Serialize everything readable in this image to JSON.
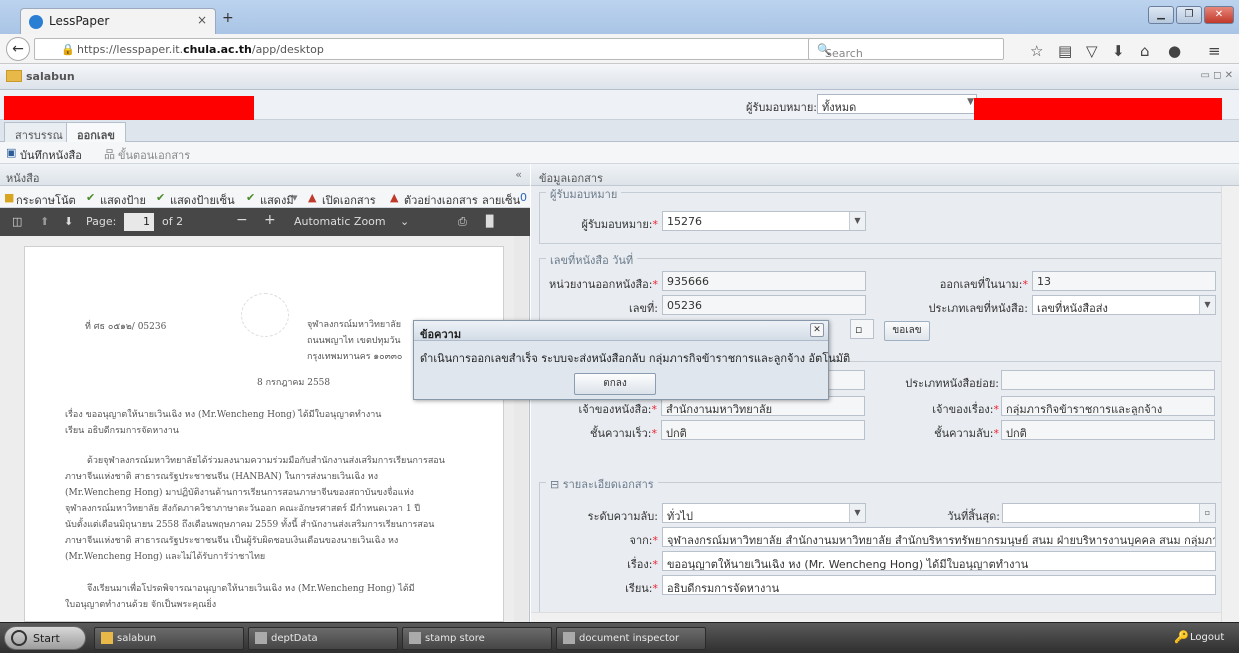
{
  "browser": {
    "tab_title": "LessPaper",
    "tab_close": "×",
    "new_tab": "+",
    "url_prefix": "https://lesspaper.it.",
    "url_host": "chula.ac.th",
    "url_path": "/app/desktop",
    "search_placeholder": "Search"
  },
  "app": {
    "window_title": "salabun",
    "filter_label": "ผู้รับมอบหมาย:",
    "filter_value": "ทั้งหมด",
    "tabs": [
      "สารบรรณ",
      "ออกเลข"
    ],
    "save_label": "บันทึกหนังสือ",
    "steps_label": "ขั้นตอนเอกสาร"
  },
  "left": {
    "header": "หนังสือ",
    "tools": [
      "กระดาษโน้ต",
      "แสดงป้าย",
      "แสดงป้ายเซ็น",
      "แสดงมี",
      "เปิดเอกสาร",
      "ตัวอย่างเอกสาร",
      "ลายเซ็น",
      "0"
    ],
    "pdf": {
      "page_label": "Page:",
      "page_num": "1",
      "page_total": "of 2",
      "zoom": "Automatic Zoom"
    },
    "doc": {
      "ref": "ที่ ศธ ๐๕๑๒/ 05236",
      "org1": "จุฬาลงกรณ์มหาวิทยาลัย",
      "org2": "ถนนพญาไท เขตปทุมวัน",
      "org3": "กรุงเทพมหานคร ๑๐๓๓๐",
      "date": "8 กรกฎาคม 2558",
      "subject": "เรื่อง ขออนุญาตให้นายเวินเฉิง หง (Mr.Wencheng Hong) ได้มีใบอนุญาตทำงาน",
      "to": "เรียน อธิบดีกรมการจัดหางาน",
      "p1": "ด้วยจุฬาลงกรณ์มหาวิทยาลัยได้ร่วมลงนามความร่วมมือกับสำนักงานส่งเสริมการเรียนการสอน",
      "p2": "ภาษาจีนแห่งชาติ สาธารณรัฐประชาชนจีน (HANBAN) ในการส่งนายเวินเฉิง หง",
      "p3": "(Mr.Wencheng Hong) มาปฏิบัติงานด้านการเรียนการสอนภาษาจีนของสถาบันขงจื่อแห่ง",
      "p4": "จุฬาลงกรณ์มหาวิทยาลัย สังกัดภาควิชาภาษาตะวันออก คณะอักษรศาสตร์ มีกำหนดเวลา 1 ปี",
      "p5": "นับตั้งแต่เดือนมิถุนายน 2558 ถึงเดือนพฤษภาคม 2559 ทั้งนี้ สำนักงานส่งเสริมการเรียนการสอน",
      "p6": "ภาษาจีนแห่งชาติ สาธารณรัฐประชาชนจีน เป็นผู้รับผิดชอบเงินเดือนของนายเวินเฉิง หง",
      "p7": "(Mr.Wencheng Hong) และไม่ได้รับการัว่าชาไทย",
      "p8": "จึงเรียนมาเพื่อโปรดพิจารณาอนุญาตให้นายเวินเฉิง หง (Mr.Wencheng Hong) ได้มี",
      "p9": "ใบอนุญาตทำงานด้วย จักเป็นพระคุณยิ่ง"
    }
  },
  "right": {
    "header": "ข้อมูลเอกสาร",
    "assignee_section": "ผู้รับมอบหมาย",
    "assignee_label": "ผู้รับมอบหมาย:",
    "assignee_value": "15276",
    "number_section": "เลขที่หนังสือ วันที่",
    "issuer_label": "หน่วยงานออกหนังสือ:",
    "issuer_value": "935666",
    "internal_label": "ออกเลขที่ในนาม:",
    "internal_value": "13",
    "no_label": "เลขที่:",
    "no_value": "05236",
    "type_label": "ประเภทเลขที่หนังสือ:",
    "type_value": "เลขที่หนังสือส่ง",
    "request_btn": "ขอเลข",
    "subtype_label": "ประเภทหนังสือย่อย:",
    "owner_label": "เจ้าของหนังสือ:",
    "owner_value": "สำนักงานมหาวิทยาลัย",
    "story_owner_label": "เจ้าของเรื่อง:",
    "story_owner_value": "กลุ่มภารกิจข้าราชการและลูกจ้าง",
    "urgency_label": "ชั้นความเร็ว:",
    "urgency_value": "ปกติ",
    "secret_label": "ชั้นความลับ:",
    "secret_value": "ปกติ",
    "detail_section": "รายละเอียดเอกสาร",
    "level_label": "ระดับความลับ:",
    "level_value": "ทั่วไป",
    "end_label": "วันที่สิ้นสุด:",
    "from_label": "จาก:",
    "from_value": "จุฬาลงกรณ์มหาวิทยาลัย สำนักงานมหาวิทยาลัย สำนักบริหารทรัพยากรมนุษย์ สนม ฝ่ายบริหารงานบุคคล สนม กลุ่มภารกิจข้าราช",
    "subject_label": "เรื่อง:",
    "subject_value": "ขออนุญาตให้นายเวินเฉิง หง (Mr. Wencheng Hong) ได้มีใบอนุญาตทำงาน",
    "to_label": "เรียน:",
    "to_value": "อธิบดีกรมการจัดหางาน"
  },
  "dialog": {
    "title": "ข้อความ",
    "message": "ดำเนินการออกเลขสำเร็จ ระบบจะส่งหนังสือกลับ กลุ่มภารกิจข้าราชการและลูกจ้าง อัตโนมัติ",
    "ok": "ตกลง"
  },
  "taskbar": {
    "start": "Start",
    "items": [
      "salabun",
      "deptData",
      "stamp store",
      "document inspector"
    ],
    "logout": "Logout"
  }
}
